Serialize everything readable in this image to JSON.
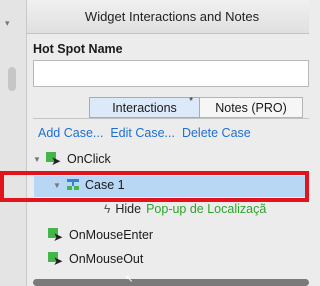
{
  "panel": {
    "title": "Widget Interactions and Notes",
    "collapse_glyph": "▾"
  },
  "hotspot": {
    "label": "Hot Spot Name",
    "value": "",
    "placeholder": ""
  },
  "tabs": [
    {
      "label": "Interactions",
      "marker": "*"
    },
    {
      "label": "Notes (PRO)"
    }
  ],
  "actions": {
    "add_case": "Add Case...",
    "edit_case": "Edit Case...",
    "delete_case": "Delete Case"
  },
  "tree": {
    "onclick": {
      "label": "OnClick",
      "icon": "event-icon"
    },
    "case1": {
      "label": "Case 1",
      "icon": "case-icon",
      "selected": true
    },
    "action": {
      "verb": "Hide",
      "target": "Pop-up de Localizaçã",
      "icon": "lightning-icon"
    },
    "onmouseenter": {
      "label": "OnMouseEnter",
      "icon": "event-icon"
    },
    "onmouseout": {
      "label": "OnMouseOut",
      "icon": "event-icon"
    }
  },
  "colors": {
    "highlight_border": "#e3131b",
    "selection_bg": "#b7d7f5",
    "link": "#1f6fd0",
    "target_text": "#2ca52c",
    "event_icon": "#44b549"
  }
}
